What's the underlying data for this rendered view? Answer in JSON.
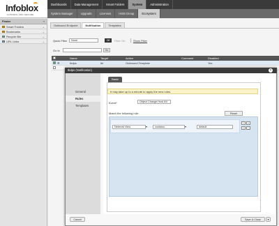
{
  "app": {
    "logo": "Infoblox",
    "logo_sub": "CONTROL AND SECURE"
  },
  "top_nav": [
    "Dashboards",
    "Data Management",
    "Smart Folders",
    "System",
    "Administration"
  ],
  "sub_nav": [
    "System Manager",
    "Upgrade",
    "Licenses",
    "HSM Group",
    "Ecosystem"
  ],
  "sidebar": {
    "title": "Finder",
    "items": [
      "Smart Folders",
      "Bookmarks",
      "Recycle Bin",
      "URL Links"
    ]
  },
  "inner_tabs": [
    "Outbound Endpoint",
    "Notification",
    "Templates"
  ],
  "quick_filter": {
    "label": "Quick Filter",
    "value": "None",
    "off": "Off",
    "apply": "Filter On",
    "show": "Show Filter"
  },
  "goto": {
    "label": "Go to",
    "button": "Go"
  },
  "table": {
    "headers": [
      "",
      "",
      "Name",
      "Target",
      "Action",
      "Comment",
      "Disabled"
    ],
    "rows": [
      {
        "name": "Ibdps",
        "target": "Ibi",
        "action": "Outbound Template",
        "comment": "",
        "disabled": "Yes"
      }
    ]
  },
  "modal": {
    "title": "Ibdps (Notification)",
    "close": "×",
    "nav": [
      "General",
      "Rules",
      "Templates"
    ],
    "basic_tab": "Basic",
    "info": "It may take up to a minute to apply the new rules.",
    "event_label": "Event*",
    "event_value": "Object Change Host Ad",
    "match_label": "Match the following rule:",
    "reset": "Reset",
    "rule": {
      "field": "Network View",
      "operator": "contains",
      "value": "default"
    },
    "cancel": "Cancel",
    "save": "Save & Close",
    "save_arrow": "▾"
  }
}
